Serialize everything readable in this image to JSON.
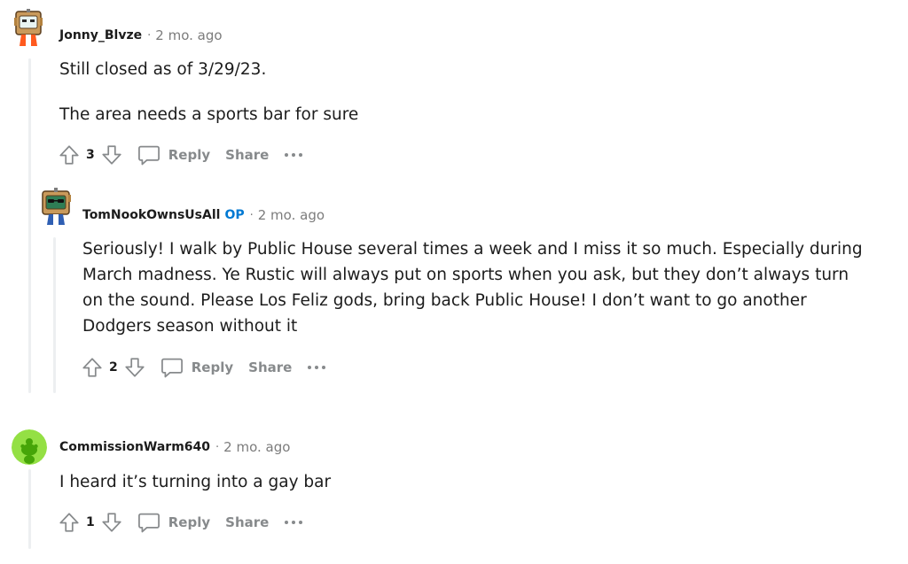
{
  "comments": [
    {
      "username": "Jonny_Blvze",
      "timestamp": "2 mo. ago",
      "paragraphs": [
        "Still closed as of 3/29/23.",
        "The area needs a sports bar for sure"
      ],
      "score": "3",
      "reply_label": "Reply",
      "share_label": "Share",
      "avatar_icon": "snoo-box-avatar-icon"
    },
    {
      "username": "TomNookOwnsUsAll",
      "badge": "OP",
      "timestamp": "2 mo. ago",
      "paragraphs": [
        "Seriously! I walk by Public House several times a week and I miss it so much. Especially during March madness. Ye Rustic will always put on sports when you ask, but they don’t always turn on the sound. Please Los Feliz gods, bring back Public House! I don’t want to go another Dodgers season without it"
      ],
      "score": "2",
      "reply_label": "Reply",
      "share_label": "Share",
      "avatar_icon": "snoo-box-sunglasses-avatar-icon"
    },
    {
      "username": "CommissionWarm640",
      "timestamp": "2 mo. ago",
      "paragraphs": [
        "I heard it’s turning into a gay bar"
      ],
      "score": "1",
      "reply_label": "Reply",
      "share_label": "Share",
      "avatar_icon": "default-snoo-avatar-icon"
    }
  ],
  "colors": {
    "op_badge": "#0079d3",
    "action_gray": "#878a8c",
    "meta_gray": "#7c7c7c",
    "thread_line": "#edeff1"
  }
}
